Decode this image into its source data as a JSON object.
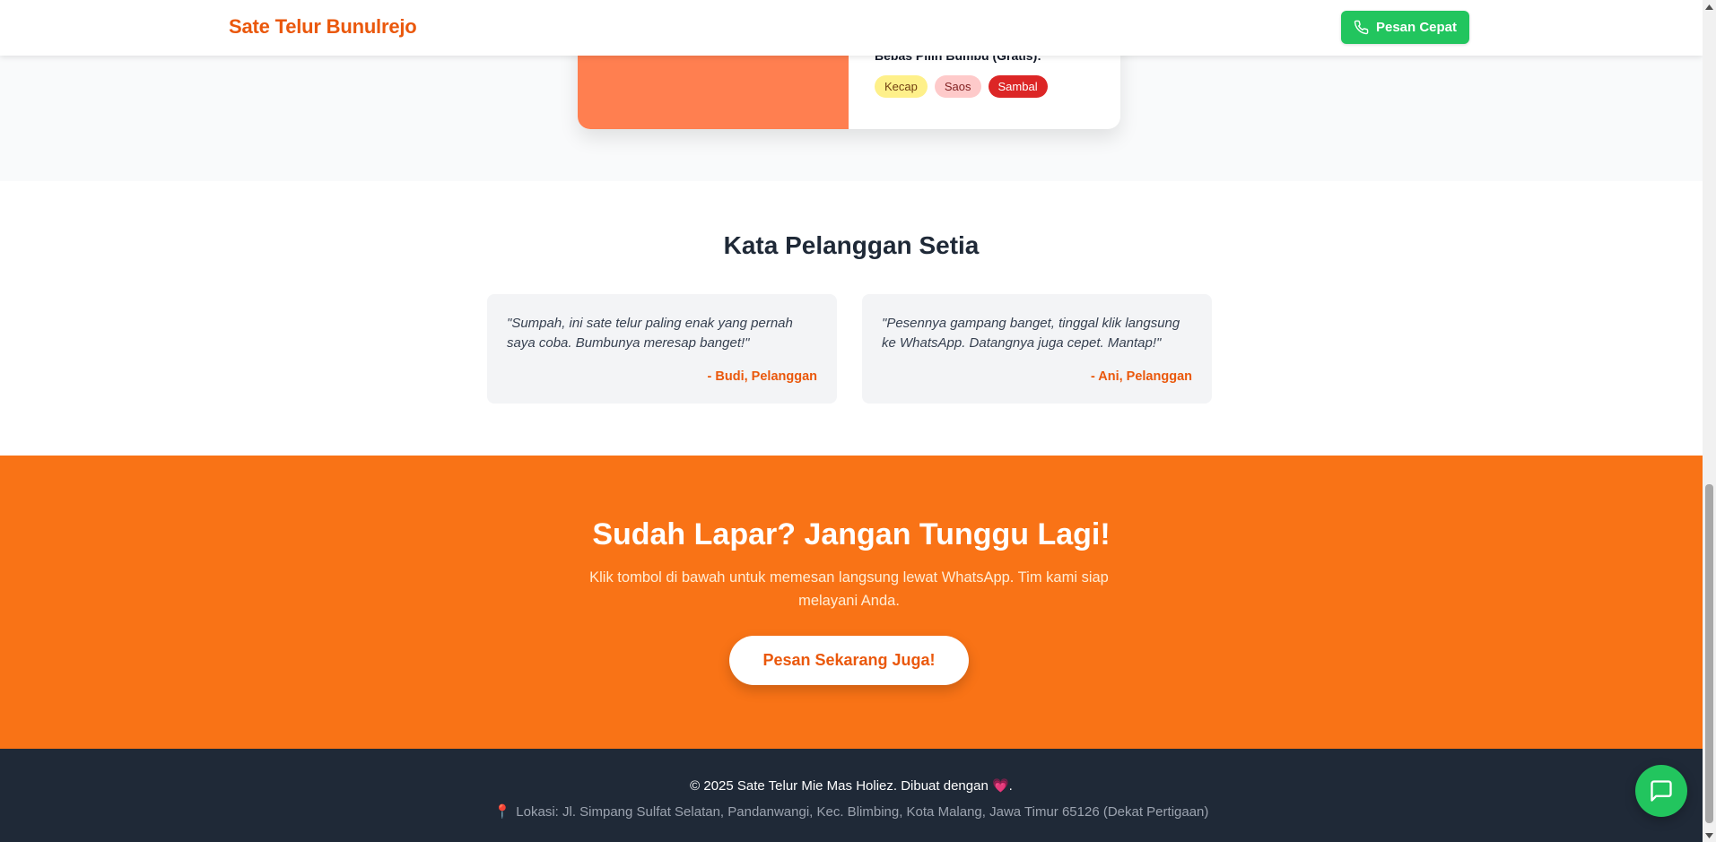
{
  "header": {
    "brand": "Sate Telur Bunulrejo",
    "quick_order_label": "Pesan Cepat"
  },
  "menu_card": {
    "addon_title": "Bebas Pilih Bumbu (Gratis):",
    "chips": [
      "Kecap",
      "Saos",
      "Sambal"
    ]
  },
  "testimonials": {
    "title": "Kata Pelanggan Setia",
    "items": [
      {
        "quote": "\"Sumpah, ini sate telur paling enak yang pernah saya coba. Bumbunya meresap banget!\"",
        "author": "- Budi, Pelanggan"
      },
      {
        "quote": "\"Pesennya gampang banget, tinggal klik langsung ke WhatsApp. Datangnya juga cepet. Mantap!\"",
        "author": "- Ani, Pelanggan"
      }
    ]
  },
  "cta": {
    "title": "Sudah Lapar? Jangan Tunggu Lagi!",
    "subtitle": "Klik tombol di bawah untuk memesan langsung lewat WhatsApp. Tim kami siap melayani Anda.",
    "button_label": "Pesan Sekarang Juga!"
  },
  "footer": {
    "copyright": "© 2025 Sate Telur Mie Mas Holiez. Dibuat dengan",
    "heart": "💗",
    "suffix": ".",
    "location": "Lokasi: Jl. Simpang Sulfat Selatan, Pandanwangi, Kec. Blimbing, Kota Malang, Jawa Timur 65126 (Dekat Pertigaan)"
  },
  "colors": {
    "brand_orange": "#ea580c",
    "cta_orange": "#f97316",
    "whatsapp_green": "#22c55e",
    "footer_dark": "#1f2937"
  },
  "icons": {
    "quick_order": "phone-icon",
    "chat": "chat-bubble-icon",
    "location": "pin-icon"
  }
}
